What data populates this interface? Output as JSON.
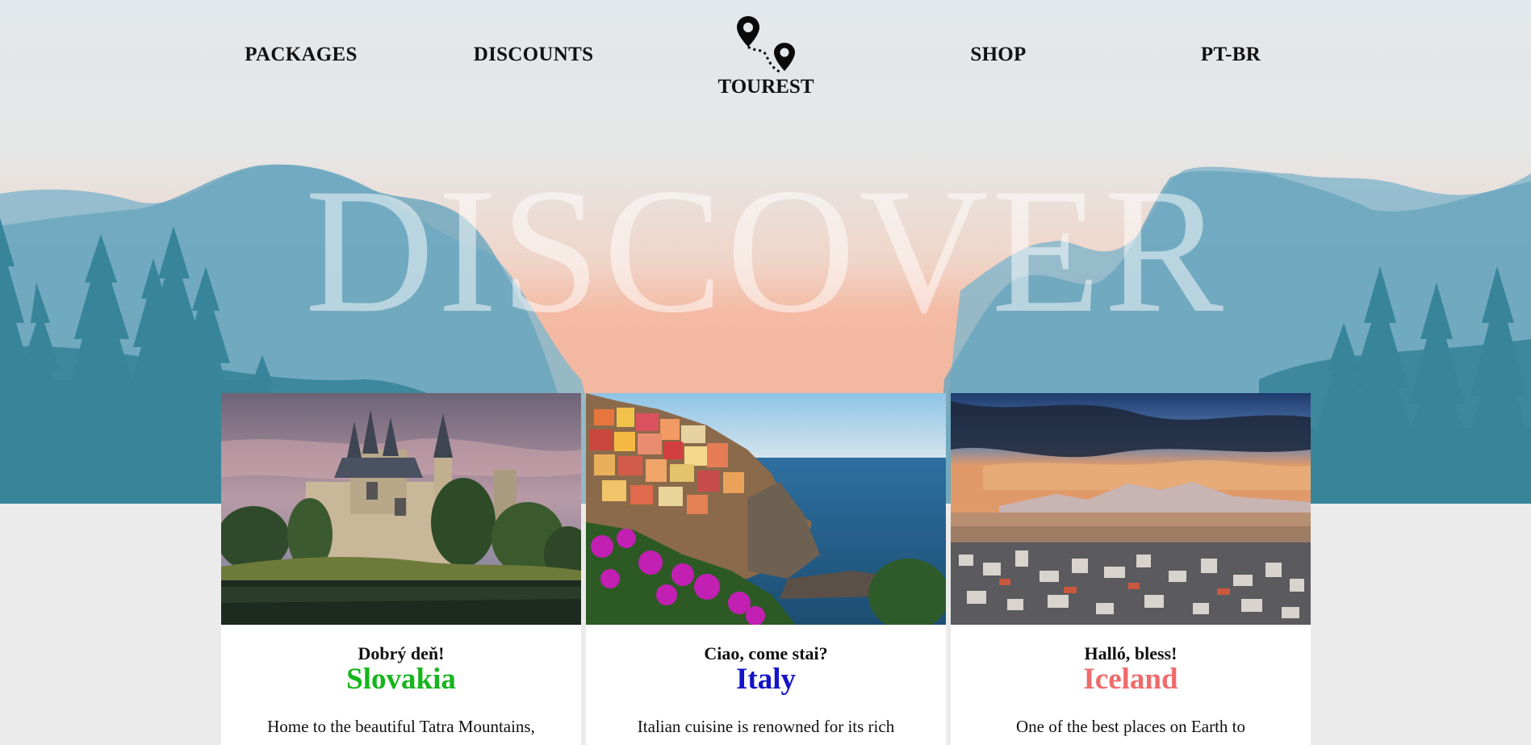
{
  "nav": {
    "links": [
      "PACKAGES",
      "DISCOUNTS",
      "SHOP",
      "PT-BR"
    ],
    "logo_text": "TOUREST",
    "logo_icon": "map-pins-route-icon"
  },
  "hero": {
    "heading": "DISCOVER"
  },
  "cards": [
    {
      "greeting": "Dobrý deň!",
      "country": "Slovakia",
      "country_color": "#16b51c",
      "description": "Home to the beautiful Tatra Mountains,",
      "photo": "castle-lake-photo"
    },
    {
      "greeting": "Ciao, come stai?",
      "country": "Italy",
      "country_color": "#1414c8",
      "description": "Italian cuisine is renowned for its rich",
      "photo": "coastal-village-photo"
    },
    {
      "greeting": "Halló, bless!",
      "country": "Iceland",
      "country_color": "#ef6b6b",
      "description": "One of the best places on Earth to",
      "photo": "city-sunset-photo"
    }
  ]
}
